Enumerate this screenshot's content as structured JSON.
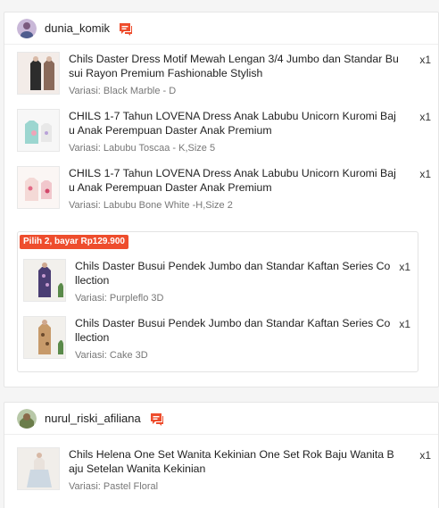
{
  "shops": [
    {
      "name": "dunia_komik",
      "items": [
        {
          "title": "Chils Daster Dress Motif Mewah Lengan 3/4 Jumbo dan Standar Busui Rayon Premium Fashionable Stylish",
          "variant": "Variasi: Black Marble - D",
          "qty": "x1"
        },
        {
          "title": "CHILS 1-7 Tahun LOVENA Dress Anak Labubu Unicorn Kuromi Baju Anak Perempuan Daster Anak Premium",
          "variant": "Variasi: Labubu Toscaa - K,Size 5",
          "qty": "x1"
        },
        {
          "title": "CHILS 1-7 Tahun LOVENA Dress Anak Labubu Unicorn Kuromi Baju Anak Perempuan Daster Anak Premium",
          "variant": "Variasi: Labubu Bone White -H,Size 2",
          "qty": "x1"
        }
      ],
      "bundle": {
        "badge": "Pilih 2, bayar Rp129.900",
        "items": [
          {
            "title": "Chils Daster Busui Pendek Jumbo dan Standar Kaftan Series Collection",
            "variant": "Variasi: Purpleflo 3D",
            "qty": "x1"
          },
          {
            "title": "Chils Daster Busui Pendek Jumbo dan Standar Kaftan Series Collection",
            "variant": "Variasi: Cake 3D",
            "qty": "x1"
          }
        ]
      }
    },
    {
      "name": "nurul_riski_afiliana",
      "items": [
        {
          "title": "Chils Helena One Set Wanita Kekinian One Set Rok Baju Wanita Baju Setelan Wanita Kekinian",
          "variant": "Variasi: Pastel Floral",
          "qty": "x1"
        }
      ]
    }
  ],
  "icons": {
    "chat": "chat-icon",
    "avatar": "avatar"
  },
  "colors": {
    "accent": "#ee4d2d"
  }
}
